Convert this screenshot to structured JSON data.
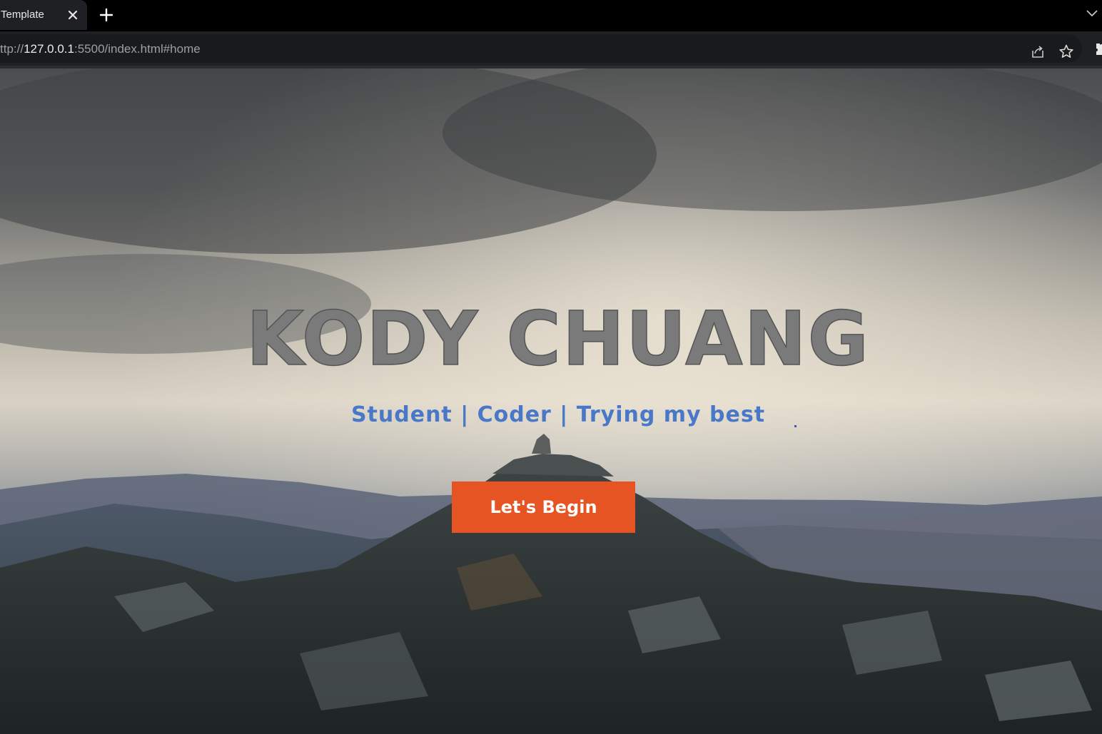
{
  "browser": {
    "tab": {
      "title": "Template"
    },
    "address_bar": {
      "url_prefix": "ttp://",
      "url_host": "127.0.0.1",
      "url_rest": ":5500/index.html#home"
    },
    "icons": {
      "tab_close": "close-icon",
      "new_tab": "plus-icon",
      "tab_list": "chevron-down-icon",
      "share": "share-icon",
      "bookmark": "star-icon",
      "extensions": "puzzle-icon"
    }
  },
  "hero": {
    "title": "KODY CHUANG",
    "subtitle": "Student | Coder | Trying my best",
    "cta_label": "Let's Begin"
  },
  "colors": {
    "title": "#7a7a7a",
    "subtitle": "#4a78c9",
    "cta_background": "#e75423",
    "cta_text": "#ffffff"
  }
}
